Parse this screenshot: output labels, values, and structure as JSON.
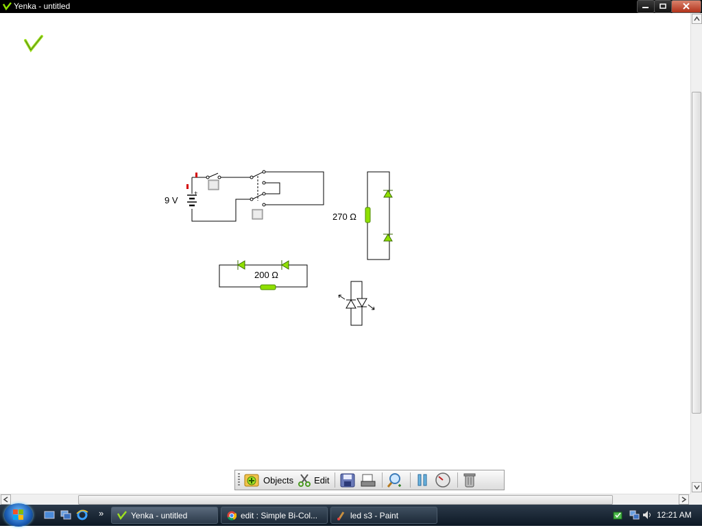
{
  "window": {
    "title": "Yenka - untitled"
  },
  "circuit": {
    "battery_label": "9 V",
    "resistor_1_label": "270 Ω",
    "resistor_2_label": "200 Ω"
  },
  "toolbar": {
    "objects_label": "Objects",
    "edit_label": "Edit"
  },
  "taskbar": {
    "quicklaunch_more": "»",
    "tasks": [
      {
        "label": "Yenka - untitled"
      },
      {
        "label": "edit : Simple Bi-Col..."
      },
      {
        "label": "led s3 - Paint"
      }
    ],
    "clock": "12:21 AM"
  },
  "colors": {
    "led_green": "#8fe000",
    "switch_red": "#d40000",
    "titlebar": "#000000"
  }
}
